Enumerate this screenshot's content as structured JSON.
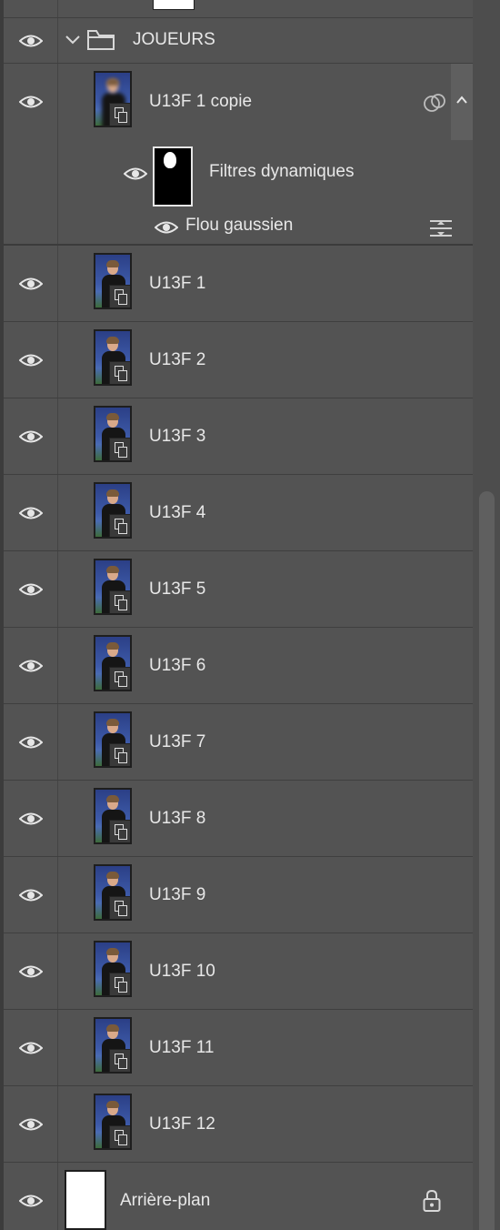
{
  "group": {
    "name": "JOUEURS"
  },
  "smart_layer": {
    "name": "U13F 1 copie"
  },
  "smart_filter": {
    "mask_label": "Filtres dynamiques",
    "effect": "Flou gaussien"
  },
  "layers": [
    {
      "name": "U13F 1"
    },
    {
      "name": "U13F 2"
    },
    {
      "name": "U13F 3"
    },
    {
      "name": "U13F 4"
    },
    {
      "name": "U13F 5"
    },
    {
      "name": "U13F 6"
    },
    {
      "name": "U13F 7"
    },
    {
      "name": "U13F 8"
    },
    {
      "name": "U13F 9"
    },
    {
      "name": "U13F 10"
    },
    {
      "name": "U13F 11"
    },
    {
      "name": "U13F 12"
    }
  ],
  "background": {
    "name": "Arrière-plan"
  },
  "icons": {
    "visibility": "eye-icon",
    "folder": "folder-icon",
    "collapse": "chevron-down-icon",
    "smart_object": "smart-object-icon",
    "linked": "linked-circles-icon",
    "collapse_effects": "chevron-up-icon",
    "filter_options": "filter-blending-options-icon",
    "lock": "lock-icon"
  },
  "colors": {
    "panel": "#535353",
    "text": "#e8e8e8"
  }
}
